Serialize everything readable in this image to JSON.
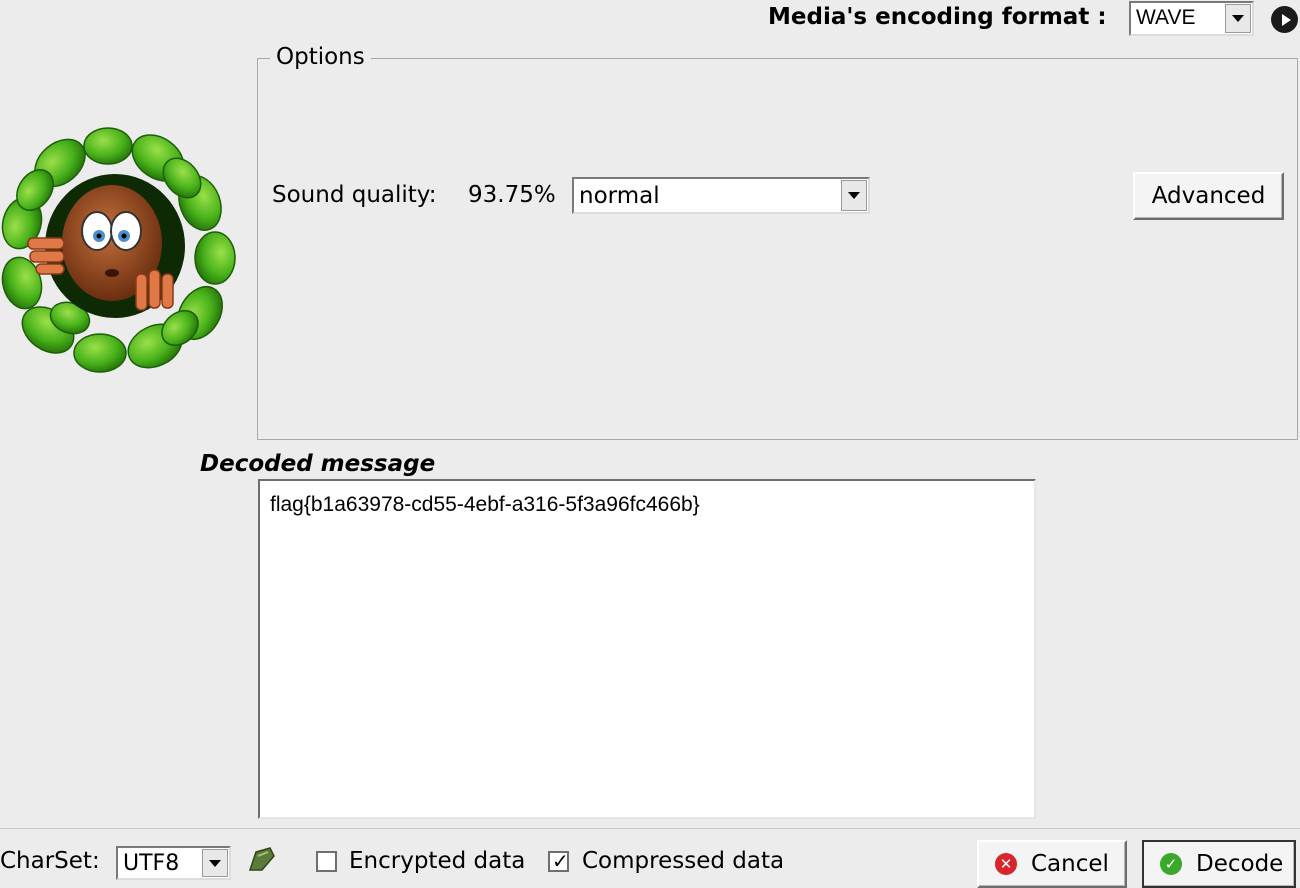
{
  "header": {
    "encoding_format_label": "Media's encoding format :",
    "encoding_format_value": "WAVE"
  },
  "options": {
    "title": "Options",
    "sound_quality_label": "Sound quality:",
    "sound_quality_value": "93.75%",
    "quality_select_value": "normal",
    "advanced_label": "Advanced"
  },
  "decoded": {
    "label": "Decoded message",
    "text": "flag{b1a63978-cd55-4ebf-a316-5f3a96fc466b}"
  },
  "footer": {
    "charset_label": "CharSet:",
    "charset_value": "UTF8",
    "encrypted_label": "Encrypted data",
    "encrypted_checked": false,
    "compressed_label": "Compressed data",
    "compressed_checked": true,
    "cancel_label": "Cancel",
    "decode_label": "Decode"
  }
}
